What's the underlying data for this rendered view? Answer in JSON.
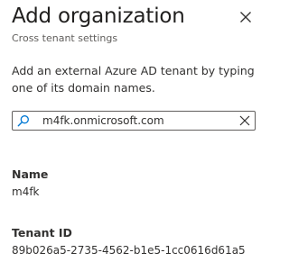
{
  "header": {
    "title": "Add organization",
    "subtitle": "Cross tenant settings"
  },
  "description": "Add an external Azure AD tenant by typing one of its domain names.",
  "search": {
    "value": "m4fk.onmicrosoft.com",
    "icon": "search-icon",
    "clear_icon": "close-icon"
  },
  "fields": {
    "name_label": "Name",
    "name_value": "m4fk",
    "tenant_id_label": "Tenant ID",
    "tenant_id_value": "89b026a5-2735-4562-b1e5-1cc0616d61a5"
  },
  "colors": {
    "text": "#323130",
    "subtle_text": "#605e5c",
    "border": "#605e5c",
    "accent": "#0078d4"
  }
}
